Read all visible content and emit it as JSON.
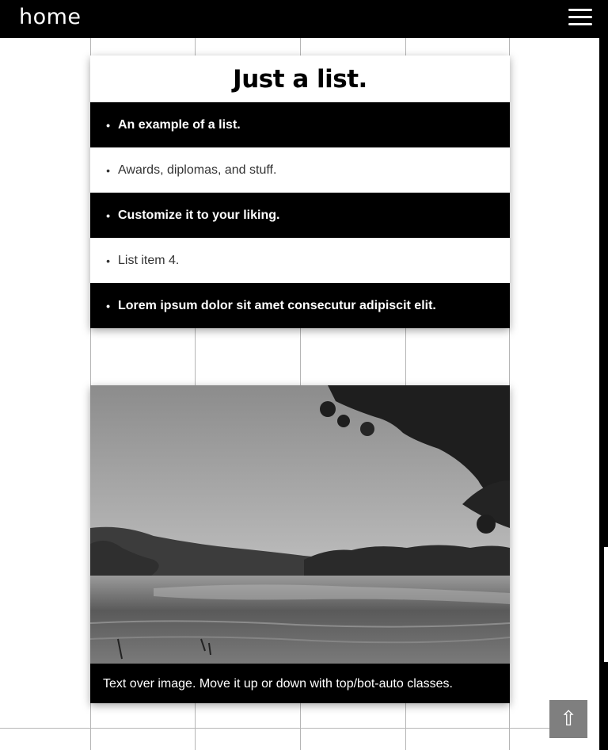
{
  "header": {
    "brand": "home",
    "menu_icon": "hamburger-menu-icon"
  },
  "list_card": {
    "title": "Just a list.",
    "items": [
      {
        "label": "An example of a list.",
        "style": "dark"
      },
      {
        "label": "Awards, diplomas, and stuff.",
        "style": "light"
      },
      {
        "label": "Customize it to your liking.",
        "style": "dark"
      },
      {
        "label": "List item 4.",
        "style": "light"
      },
      {
        "label": "Lorem ipsum dolor sit amet consecutur adipiscit elit.",
        "style": "dark"
      }
    ],
    "bullet": "•"
  },
  "image_card": {
    "caption": "Text over image. Move it up or down with top/bot-auto classes."
  },
  "back_to_top": {
    "icon": "up-arrow-icon",
    "glyph": "⇧"
  },
  "colors": {
    "header_bg": "#000000",
    "dark_row": "#000000",
    "light_row": "#ffffff",
    "grid_line": "#b5b5b5",
    "back_to_top_bg": "#7f7f7f"
  }
}
